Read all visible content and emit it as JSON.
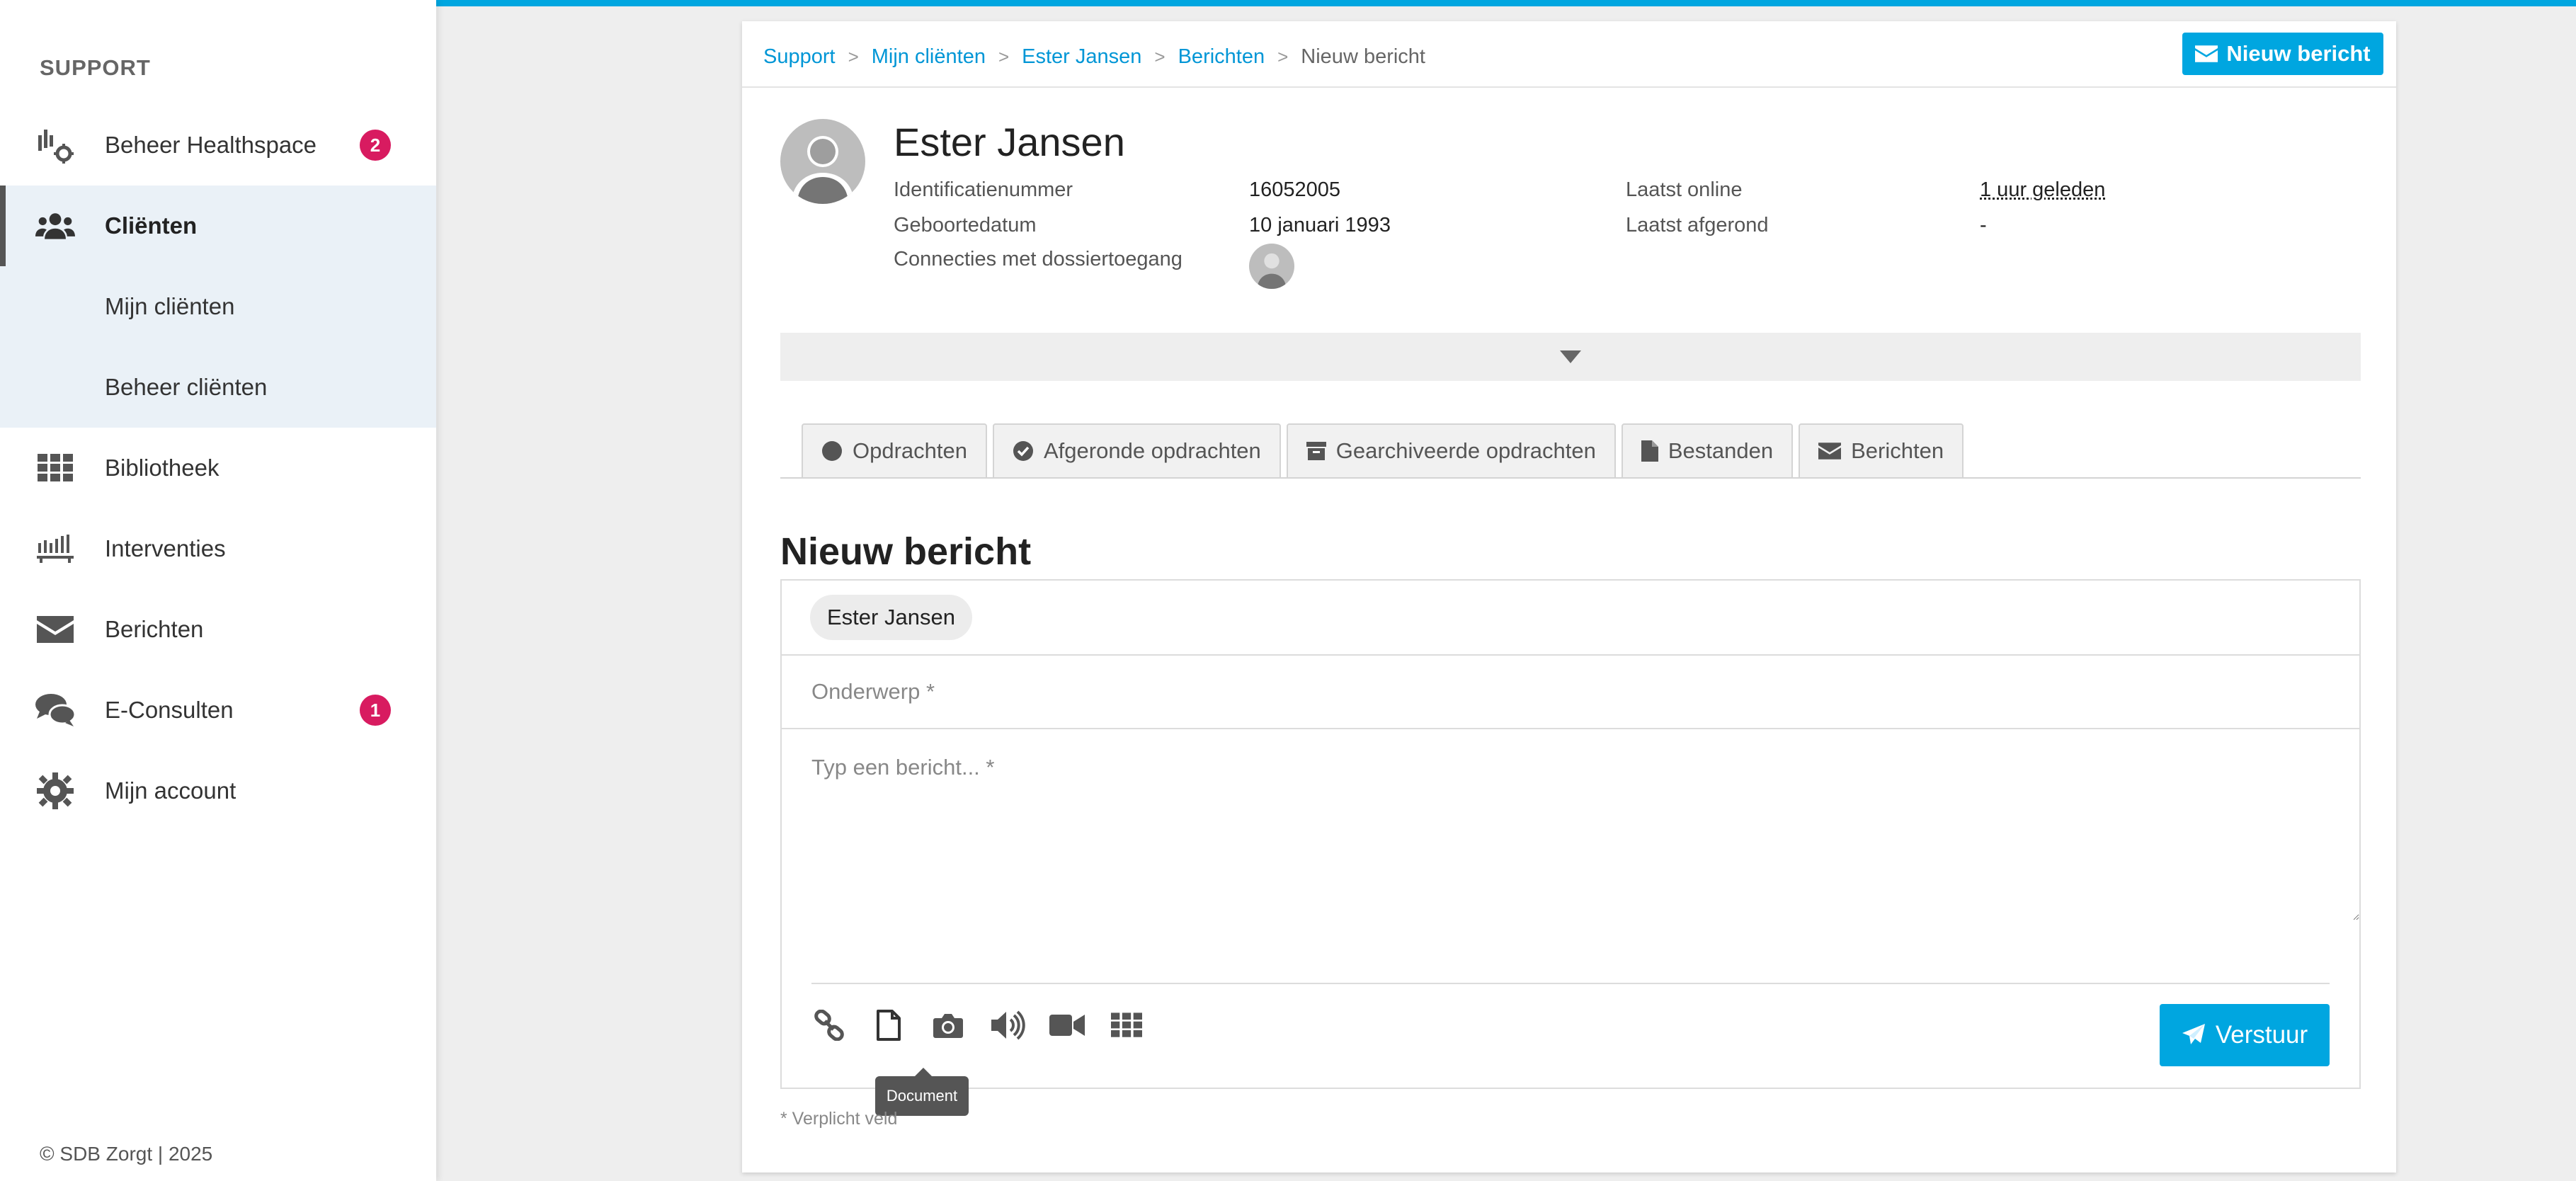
{
  "colors": {
    "accent": "#00a6e0",
    "badge": "#d81b60",
    "sidebar_active_bg": "#eaf1f7"
  },
  "sidebar": {
    "heading": "SUPPORT",
    "items": [
      {
        "label": "Beheer Healthspace",
        "icon": "healthspace-settings-icon",
        "badge": "2"
      },
      {
        "label": "Cliënten",
        "icon": "users-icon",
        "active": true
      },
      {
        "label": "Mijn cliënten",
        "sub": true
      },
      {
        "label": "Beheer cliënten",
        "sub": true
      },
      {
        "label": "Bibliotheek",
        "icon": "grid-icon"
      },
      {
        "label": "Interventies",
        "icon": "interventions-icon"
      },
      {
        "label": "Berichten",
        "icon": "envelope-icon"
      },
      {
        "label": "E-Consulten",
        "icon": "chat-bubbles-icon",
        "badge": "1"
      },
      {
        "label": "Mijn account",
        "icon": "gear-icon"
      }
    ],
    "copyright": "© SDB Zorgt | 2025"
  },
  "breadcrumb": [
    "Support",
    "Mijn cliënten",
    "Ester Jansen",
    "Berichten",
    "Nieuw bericht"
  ],
  "header": {
    "new_message_label": "Nieuw bericht"
  },
  "client": {
    "name": "Ester Jansen",
    "id_label": "Identificatienummer",
    "id_value": "16052005",
    "dob_label": "Geboortedatum",
    "dob_value": "10 januari 1993",
    "connections_label": "Connecties met dossiertoegang",
    "last_online_label": "Laatst online",
    "last_online_value": "1 uur geleden",
    "last_completed_label": "Laatst afgerond",
    "last_completed_value": "-"
  },
  "tabs": [
    {
      "label": "Opdrachten",
      "icon": "circle-icon"
    },
    {
      "label": "Afgeronde opdrachten",
      "icon": "check-circle-icon"
    },
    {
      "label": "Gearchiveerde opdrachten",
      "icon": "archive-icon"
    },
    {
      "label": "Bestanden",
      "icon": "file-icon"
    },
    {
      "label": "Berichten",
      "icon": "envelope-icon"
    }
  ],
  "compose": {
    "title": "Nieuw bericht",
    "recipient": "Ester Jansen",
    "subject_placeholder": "Onderwerp *",
    "message_placeholder": "Typ een bericht... *",
    "tooltip": "Document",
    "send_label": "Verstuur",
    "required_note": "* Verplicht veld"
  }
}
